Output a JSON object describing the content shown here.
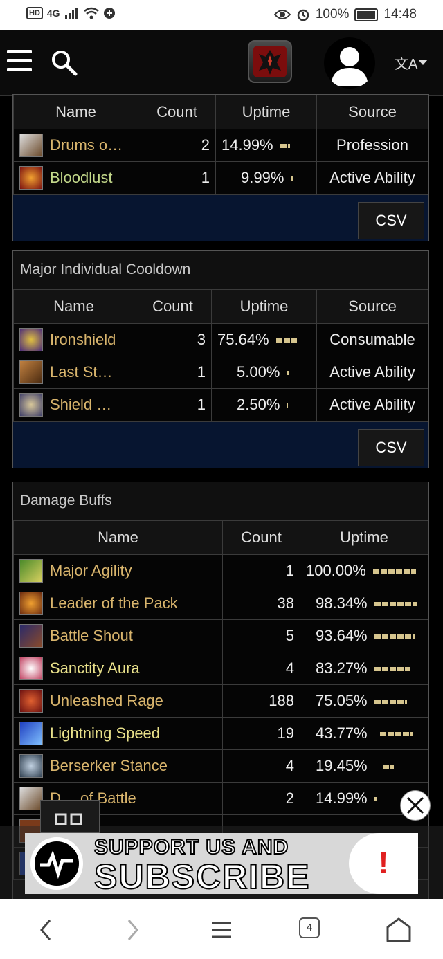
{
  "status_bar": {
    "network": "HD",
    "signal": "4G",
    "battery": "100%",
    "time": "14:48"
  },
  "header": {
    "menu_icon": "hamburger-icon",
    "search_icon": "search-icon",
    "logo_icon": "horde-logo",
    "avatar_icon": "user-avatar-icon",
    "language_icon": "translate-icon",
    "language_glyph": "文A"
  },
  "panel_top": {
    "columns": [
      "Name",
      "Count",
      "Uptime",
      "Source"
    ],
    "rows": [
      {
        "name": "Drums o…",
        "count": "2",
        "uptime": "14.99%",
        "uptime_pct": 14.99,
        "source": "Profession",
        "color": "#d9b56d"
      },
      {
        "name": "Bloodlust",
        "count": "1",
        "uptime": "9.99%",
        "uptime_pct": 9.99,
        "source": "Active Ability",
        "color": "#c3d88a"
      }
    ],
    "csv_label": "CSV"
  },
  "panel_cooldown": {
    "title": "Major Individual Cooldown",
    "columns": [
      "Name",
      "Count",
      "Uptime",
      "Source"
    ],
    "rows": [
      {
        "name": "Ironshield",
        "count": "3",
        "uptime": "75.64%",
        "uptime_pct": 75.64,
        "source": "Consumable"
      },
      {
        "name": "Last St…",
        "count": "1",
        "uptime": "5.00%",
        "uptime_pct": 5.0,
        "source": "Active Ability"
      },
      {
        "name": "Shield …",
        "count": "1",
        "uptime": "2.50%",
        "uptime_pct": 2.5,
        "source": "Active Ability"
      }
    ],
    "csv_label": "CSV"
  },
  "panel_damage": {
    "title": "Damage Buffs",
    "columns": [
      "Name",
      "Count",
      "Uptime"
    ],
    "rows": [
      {
        "name": "Major Agility",
        "count": "1",
        "uptime": "100.00%",
        "uptime_pct": 100.0,
        "color": "#d9b56d"
      },
      {
        "name": "Leader of the Pack",
        "count": "38",
        "uptime": "98.34%",
        "uptime_pct": 98.34,
        "color": "#d9b56d"
      },
      {
        "name": "Battle Shout",
        "count": "5",
        "uptime": "93.64%",
        "uptime_pct": 93.64,
        "color": "#d9b56d"
      },
      {
        "name": "Sanctity Aura",
        "count": "4",
        "uptime": "83.27%",
        "uptime_pct": 83.27,
        "color": "#e8e08a"
      },
      {
        "name": "Unleashed Rage",
        "count": "188",
        "uptime": "75.05%",
        "uptime_pct": 75.05,
        "color": "#d9b56d"
      },
      {
        "name": "Lightning Speed",
        "count": "19",
        "uptime": "43.77%",
        "uptime_pct": 43.77,
        "color": "#e8e08a"
      },
      {
        "name": "Berserker Stance",
        "count": "4",
        "uptime": "19.45%",
        "uptime_pct": 19.45,
        "color": "#d9b56d"
      },
      {
        "name": "D… of Battle",
        "count": "2",
        "uptime": "14.99%",
        "uptime_pct": 14.99,
        "color": "#d9b56d"
      }
    ]
  },
  "ad": {
    "line1": "SUPPORT US AND",
    "line2": "SUBSCRIBE",
    "alert": "!"
  },
  "navbar": {
    "tabs_count": "4"
  }
}
